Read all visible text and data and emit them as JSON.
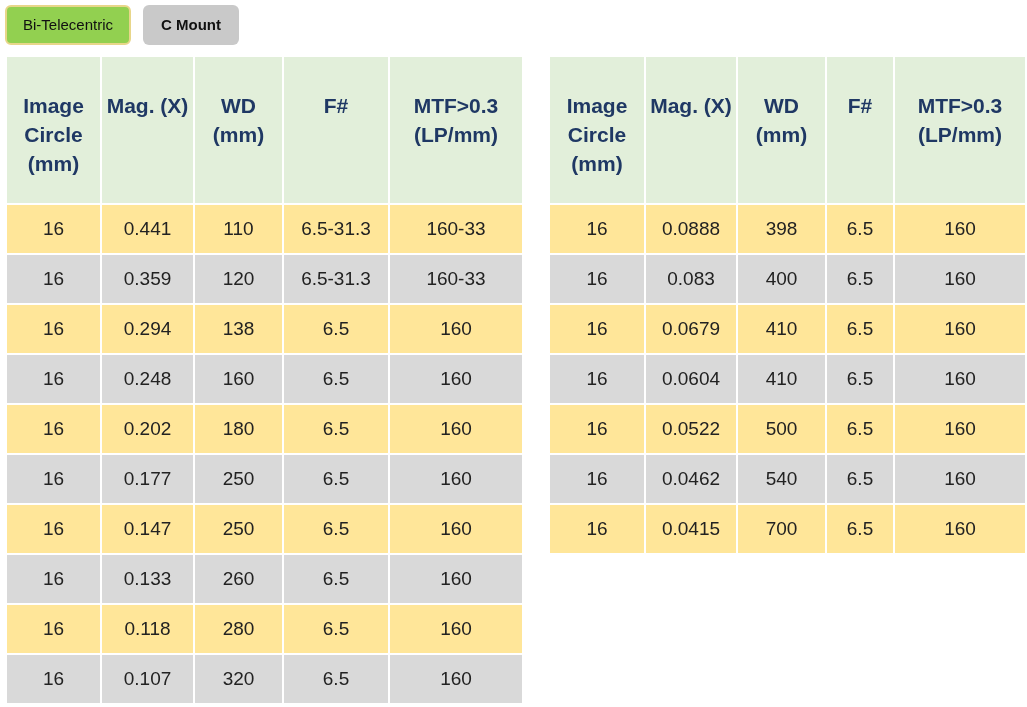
{
  "filters": [
    {
      "label": "Bi-Telecentric",
      "selected": true
    },
    {
      "label": "C Mount",
      "selected": false
    }
  ],
  "tables": [
    {
      "columns": [
        "Image Circle (mm)",
        "Mag. (X)",
        "WD (mm)",
        "F#",
        "MTF>0.3 (LP/mm)"
      ],
      "rows": [
        [
          "16",
          "0.441",
          "110",
          "6.5-31.3",
          "160-33"
        ],
        [
          "16",
          "0.359",
          "120",
          "6.5-31.3",
          "160-33"
        ],
        [
          "16",
          "0.294",
          "138",
          "6.5",
          "160"
        ],
        [
          "16",
          "0.248",
          "160",
          "6.5",
          "160"
        ],
        [
          "16",
          "0.202",
          "180",
          "6.5",
          "160"
        ],
        [
          "16",
          "0.177",
          "250",
          "6.5",
          "160"
        ],
        [
          "16",
          "0.147",
          "250",
          "6.5",
          "160"
        ],
        [
          "16",
          "0.133",
          "260",
          "6.5",
          "160"
        ],
        [
          "16",
          "0.118",
          "280",
          "6.5",
          "160"
        ],
        [
          "16",
          "0.107",
          "320",
          "6.5",
          "160"
        ]
      ]
    },
    {
      "columns": [
        "Image Circle (mm)",
        "Mag. (X)",
        "WD (mm)",
        "F#",
        "MTF>0.3 (LP/mm)"
      ],
      "rows": [
        [
          "16",
          "0.0888",
          "398",
          "6.5",
          "160"
        ],
        [
          "16",
          "0.083",
          "400",
          "6.5",
          "160"
        ],
        [
          "16",
          "0.0679",
          "410",
          "6.5",
          "160"
        ],
        [
          "16",
          "0.0604",
          "410",
          "6.5",
          "160"
        ],
        [
          "16",
          "0.0522",
          "500",
          "6.5",
          "160"
        ],
        [
          "16",
          "0.0462",
          "540",
          "6.5",
          "160"
        ],
        [
          "16",
          "0.0415",
          "700",
          "6.5",
          "160"
        ]
      ]
    }
  ]
}
